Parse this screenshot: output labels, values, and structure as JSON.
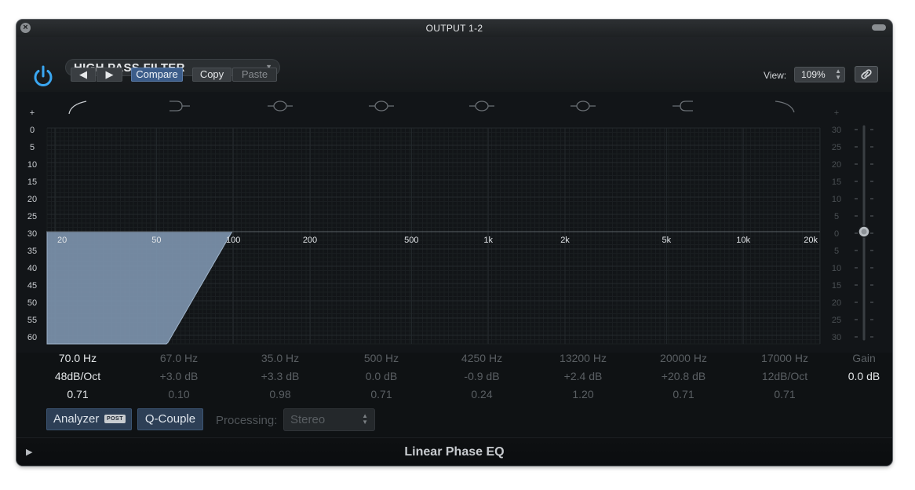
{
  "window": {
    "title": "OUTPUT 1-2",
    "close_glyph": "×"
  },
  "header": {
    "preset": "HIGH PASS FILTER",
    "buttons": {
      "prev": "◀",
      "next": "▶",
      "compare": "Compare",
      "copy": "Copy",
      "paste": "Paste"
    },
    "view_label": "View:",
    "view_value": "109%"
  },
  "graph": {
    "left_scale": [
      "+",
      "0",
      "5",
      "10",
      "15",
      "20",
      "25",
      "30",
      "35",
      "40",
      "45",
      "50",
      "55",
      "60",
      "-"
    ],
    "right_scale": [
      "+",
      "30",
      "25",
      "20",
      "15",
      "10",
      "5",
      "0",
      "5",
      "10",
      "15",
      "20",
      "25",
      "30",
      "-"
    ],
    "freq_labels": [
      "20",
      "50",
      "100",
      "200",
      "500",
      "1k",
      "2k",
      "5k",
      "10k",
      "20k"
    ],
    "band_icons": [
      "high-pass-curve-icon",
      "low-shelf-icon",
      "bell-icon",
      "bell-icon",
      "bell-icon",
      "bell-icon",
      "high-shelf-icon",
      "low-pass-curve-icon"
    ],
    "high_pass": {
      "frequency_hz": 70.0,
      "slope_db_oct": 48
    },
    "fill_color": "#7c93ad",
    "gain_db": 0.0
  },
  "bands": [
    {
      "freq": "70.0 Hz",
      "gain": "48dB/Oct",
      "q": "0.71",
      "active": true
    },
    {
      "freq": "67.0 Hz",
      "gain": "+3.0 dB",
      "q": "0.10",
      "active": false
    },
    {
      "freq": "35.0 Hz",
      "gain": "+3.3 dB",
      "q": "0.98",
      "active": false
    },
    {
      "freq": "500 Hz",
      "gain": "0.0 dB",
      "q": "0.71",
      "active": false
    },
    {
      "freq": "4250 Hz",
      "gain": "-0.9 dB",
      "q": "0.24",
      "active": false
    },
    {
      "freq": "13200 Hz",
      "gain": "+2.4 dB",
      "q": "1.20",
      "active": false
    },
    {
      "freq": "20000 Hz",
      "gain": "+20.8 dB",
      "q": "0.71",
      "active": false
    },
    {
      "freq": "17000 Hz",
      "gain": "12dB/Oct",
      "q": "0.71",
      "active": false
    }
  ],
  "gain": {
    "label": "Gain",
    "value": "0.0 dB"
  },
  "controls": {
    "analyzer": "Analyzer",
    "analyzer_badge": "POST",
    "q_couple": "Q-Couple",
    "processing_label": "Processing:",
    "processing_value": "Stereo"
  },
  "footer": {
    "plugin_name": "Linear Phase EQ",
    "disclosure_glyph": "▶"
  }
}
